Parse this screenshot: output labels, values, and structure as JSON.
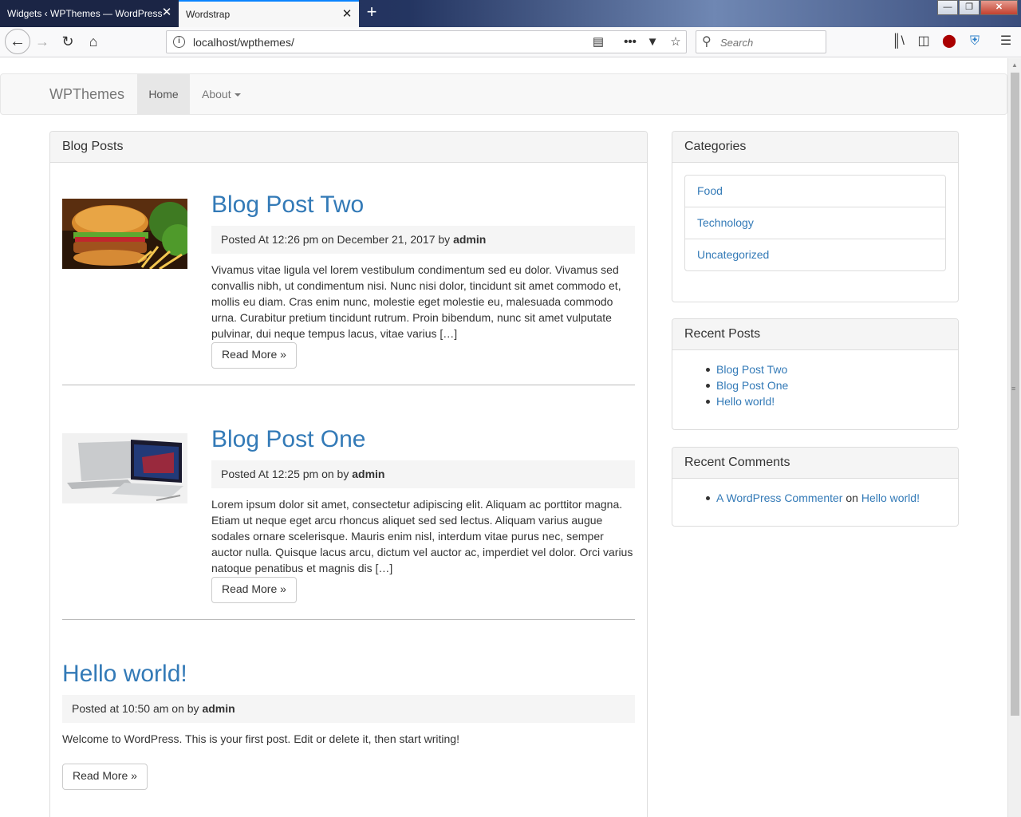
{
  "browser": {
    "tabs": [
      {
        "title": "Widgets ‹ WPThemes — WordPress",
        "active": false
      },
      {
        "title": "Wordstrap",
        "active": true
      }
    ],
    "new_tab": "+",
    "url": "localhost/wpthemes/",
    "search_placeholder": "Search",
    "icons": [
      "back-icon",
      "forward-icon",
      "reload-icon",
      "home-icon",
      "info-icon",
      "reader-view-icon",
      "more-actions-icon",
      "pocket-icon",
      "bookmark-star-icon",
      "library-icon",
      "sidebar-icon",
      "ublock-icon",
      "shield-extension-icon",
      "menu-icon"
    ],
    "window_controls": {
      "min": "—",
      "max": "❐",
      "close": "✕"
    }
  },
  "site": {
    "brand": "WPThemes",
    "nav": {
      "home": "Home",
      "about": "About"
    }
  },
  "main": {
    "panel_title": "Blog Posts",
    "posts": [
      {
        "title": "Blog Post Two",
        "meta_prefix": "Posted At 12:26 pm on December 21, 2017 by",
        "author": "admin",
        "excerpt": "Vivamus vitae ligula vel lorem vestibulum condimentum sed eu dolor. Vivamus sed convallis nibh, ut condimentum nisi. Nunc nisi dolor, tincidunt sit amet commodo et, mollis eu diam. Cras enim nunc, molestie eget molestie eu, malesuada commodo urna. Curabitur pretium tincidunt rutrum. Proin bibendum, nunc sit amet vulputate pulvinar, dui neque tempus lacus, vitae varius […]",
        "read_more": "Read More »",
        "image": "burger-photo"
      },
      {
        "title": "Blog Post One",
        "meta_prefix": "Posted At 12:25 pm on by",
        "author": "admin",
        "excerpt": "Lorem ipsum dolor sit amet, consectetur adipiscing elit. Aliquam ac porttitor magna. Etiam ut neque eget arcu rhoncus aliquet sed sed lectus. Aliquam varius augue sodales ornare scelerisque. Mauris enim nisl, interdum vitae purus nec, semper auctor nulla. Quisque lacus arcu, dictum vel auctor ac, imperdiet vel dolor. Orci varius natoque penatibus et magnis dis […]",
        "read_more": "Read More »",
        "image": "laptop-photo"
      },
      {
        "title": "Hello world!",
        "meta_prefix": "Posted at 10:50 am on by",
        "author": "admin",
        "excerpt": "Welcome to WordPress. This is your first post. Edit or delete it, then start writing!",
        "read_more": "Read More »"
      }
    ]
  },
  "sidebar": {
    "categories": {
      "title": "Categories",
      "items": [
        "Food",
        "Technology",
        "Uncategorized"
      ]
    },
    "recent_posts": {
      "title": "Recent Posts",
      "items": [
        "Blog Post Two",
        "Blog Post One",
        "Hello world!"
      ]
    },
    "recent_comments": {
      "title": "Recent Comments",
      "items": [
        {
          "author": "A WordPress Commenter",
          "on": "on",
          "post": "Hello world!"
        }
      ]
    }
  },
  "colors": {
    "link": "#337ab7",
    "panel_heading_bg": "#f5f5f5",
    "navbar_bg": "#f8f8f8",
    "meta_bg": "#f5f5f5"
  }
}
